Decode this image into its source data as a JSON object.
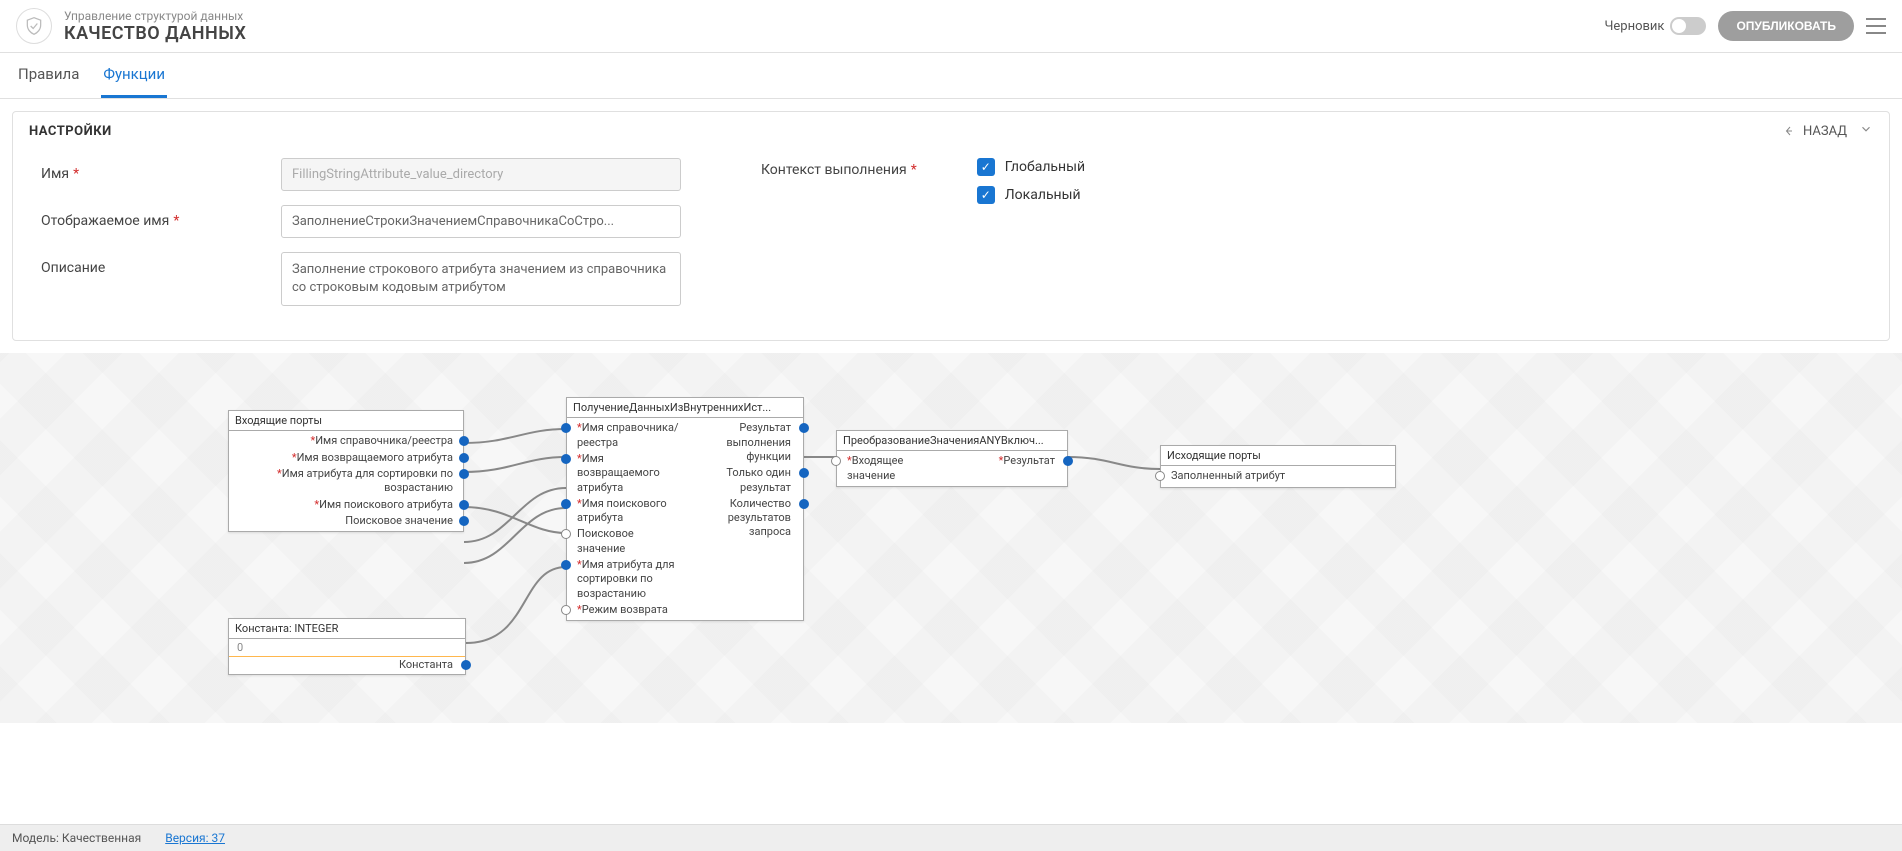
{
  "header": {
    "subtitle": "Управление структурой данных",
    "title": "КАЧЕСТВО ДАННЫХ",
    "draft_label": "Черновик",
    "publish_label": "ОПУБЛИКОВАТЬ"
  },
  "tabs": {
    "rules": "Правила",
    "functions": "Функции"
  },
  "panel": {
    "title": "НАСТРОЙКИ",
    "back": "НАЗАД"
  },
  "form": {
    "name_label": "Имя",
    "name_value": "FillingStringAttribute_value_directory",
    "display_label": "Отображаемое имя",
    "display_value": "ЗаполнениеСтрокиЗначениемСправочникаСоСтро...",
    "desc_label": "Описание",
    "desc_value": "Заполнение строкового атрибута значением из справочника со строковым кодовым атрибутом",
    "context_label": "Контекст выполнения",
    "global": "Глобальный",
    "local": "Локальный"
  },
  "nodes": {
    "incoming": {
      "title": "Входящие порты",
      "ports": [
        "Имя справочника/реестра",
        "Имя возвращаемого атрибута",
        "Имя атрибута для сортировки по возрастанию",
        "Имя поискового атрибута",
        "Поисковое значение"
      ]
    },
    "fetch": {
      "title": "ПолучениеДанныхИзВнутреннихИст...",
      "inputs": [
        "Имя справочника/реестра",
        "Имя возвращаемого атрибута",
        "Имя поискового атрибута",
        "Поисковое значение",
        "Имя атрибута для сортировки по возрастанию",
        "Режим возврата"
      ],
      "outputs": [
        "Результат выполнения функции",
        "Только один результат",
        "Количество результатов запроса"
      ]
    },
    "transform": {
      "title": "ПреобразованиеЗначенияANYВключ...",
      "in": "Входящее значение",
      "out": "Результат"
    },
    "outgoing": {
      "title": "Исходящие порты",
      "port": "Заполненный атрибут"
    },
    "const": {
      "title": "Константа: INTEGER",
      "value": "0",
      "out": "Константа"
    }
  },
  "footer": {
    "model_label": "Модель:",
    "model_value": "Качественная",
    "version_label": "Версия:",
    "version_value": "37"
  }
}
